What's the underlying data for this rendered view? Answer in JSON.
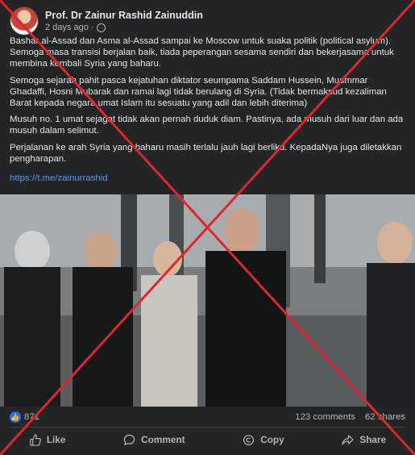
{
  "post": {
    "author": "Prof. Dr Zainur Rashid Zainuddin",
    "time": "2 days ago ·",
    "paragraphs": [
      "Bashar al-Assad dan Asma al-Assad sampai ke Moscow untuk suaka politik (political asylum). Semoga masa transisi berjalan baik, tiada peperangan sesama sendiri dan bekerjasama untuk membina kembali Syria yang baharu.",
      "Semoga sejarah pahit pasca kejatuhan diktator seumpama Saddam Hussein, Muammar Ghadaffi, Hosni Mubarak dan ramai lagi tidak berulang di Syria. (Tidak bermaksud kezaliman Barat kepada negara umat Islam itu sesuatu yang adil dan lebih diterima)",
      "Musuh no. 1 umat sejagat tidak akan pernah duduk diam. Pastinya, ada musuh dari luar dan ada musuh dalam selimut.",
      "Perjalanan ke arah Syria yang baharu masih terlalu jauh lagi berliku. KepadaNya juga diletakkan pengharapan."
    ],
    "link": "https://t.me/zainurrashid"
  },
  "stats": {
    "reactions": "871",
    "comments": "123 comments",
    "shares": "62 shares"
  },
  "actions": {
    "like": "Like",
    "comment": "Comment",
    "copy": "Copy",
    "share": "Share"
  },
  "colors": {
    "background": "#242526",
    "link": "#4599ff",
    "like_blue": "#1877f2",
    "cross_red": "#e0262a"
  },
  "icons": [
    "globe-icon",
    "like-icon",
    "comment-icon",
    "copy-icon",
    "share-icon",
    "red-x-mark"
  ]
}
